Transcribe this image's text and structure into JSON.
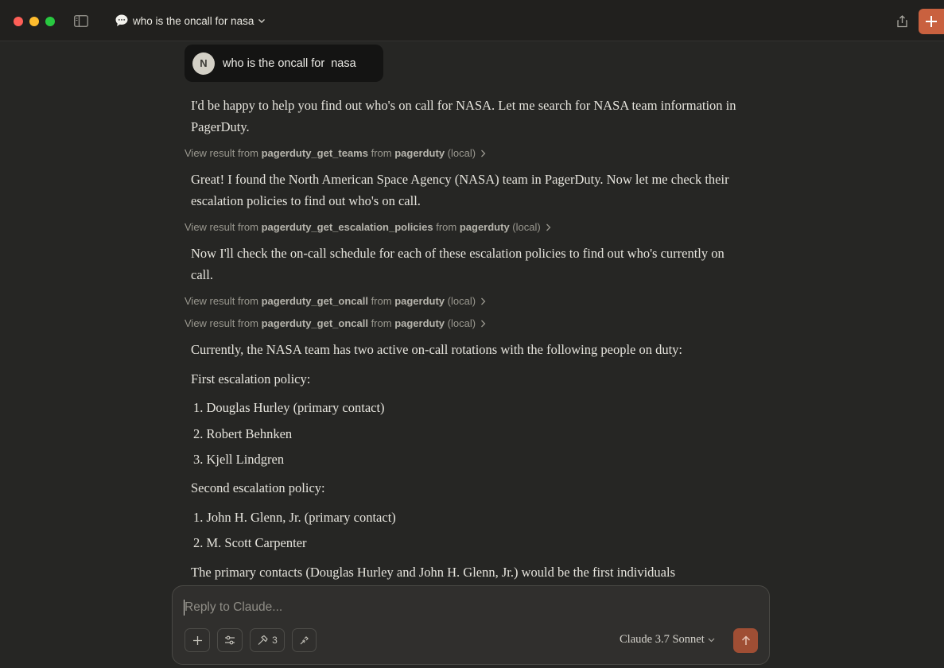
{
  "window": {
    "chat_title": "who is the oncall for nasa"
  },
  "user_message": {
    "avatar_initial": "N",
    "text": "who is the oncall for  nasa"
  },
  "assistant": {
    "intro": "I'd be happy to help you find out who's on call for NASA. Let me search for NASA team information in PagerDuty.",
    "tool1": {
      "prefix": "View result from ",
      "tool": "pagerduty_get_teams",
      "mid": " from ",
      "server": "pagerduty",
      "suffix": " (local)"
    },
    "after_teams": "Great! I found the North American Space Agency (NASA) team in PagerDuty. Now let me check their escalation policies to find out who's on call.",
    "tool2": {
      "prefix": "View result from ",
      "tool": "pagerduty_get_escalation_policies",
      "mid": " from ",
      "server": "pagerduty",
      "suffix": " (local)"
    },
    "after_policies": "Now I'll check the on-call schedule for each of these escalation policies to find out who's currently on call.",
    "tool3": {
      "prefix": "View result from ",
      "tool": "pagerduty_get_oncall",
      "mid": " from ",
      "server": "pagerduty",
      "suffix": " (local)"
    },
    "tool4": {
      "prefix": "View result from ",
      "tool": "pagerduty_get_oncall",
      "mid": " from ",
      "server": "pagerduty",
      "suffix": " (local)"
    },
    "summary": "Currently, the NASA team has two active on-call rotations with the following people on duty:",
    "policy1_heading": "First escalation policy:",
    "policy1_items": [
      "1. Douglas Hurley (primary contact)",
      "2. Robert Behnken",
      "3. Kjell Lindgren"
    ],
    "policy2_heading": "Second escalation policy:",
    "policy2_items": [
      "1. John H. Glenn, Jr. (primary contact)",
      "2. M. Scott Carpenter"
    ],
    "closing": "The primary contacts (Douglas Hurley and John H. Glenn, Jr.) would be the first individuals"
  },
  "composer": {
    "placeholder": "Reply to Claude...",
    "tools_count": "3",
    "model": "Claude 3.7 Sonnet"
  },
  "colors": {
    "accent": "#c9613f",
    "background": "#262624"
  }
}
